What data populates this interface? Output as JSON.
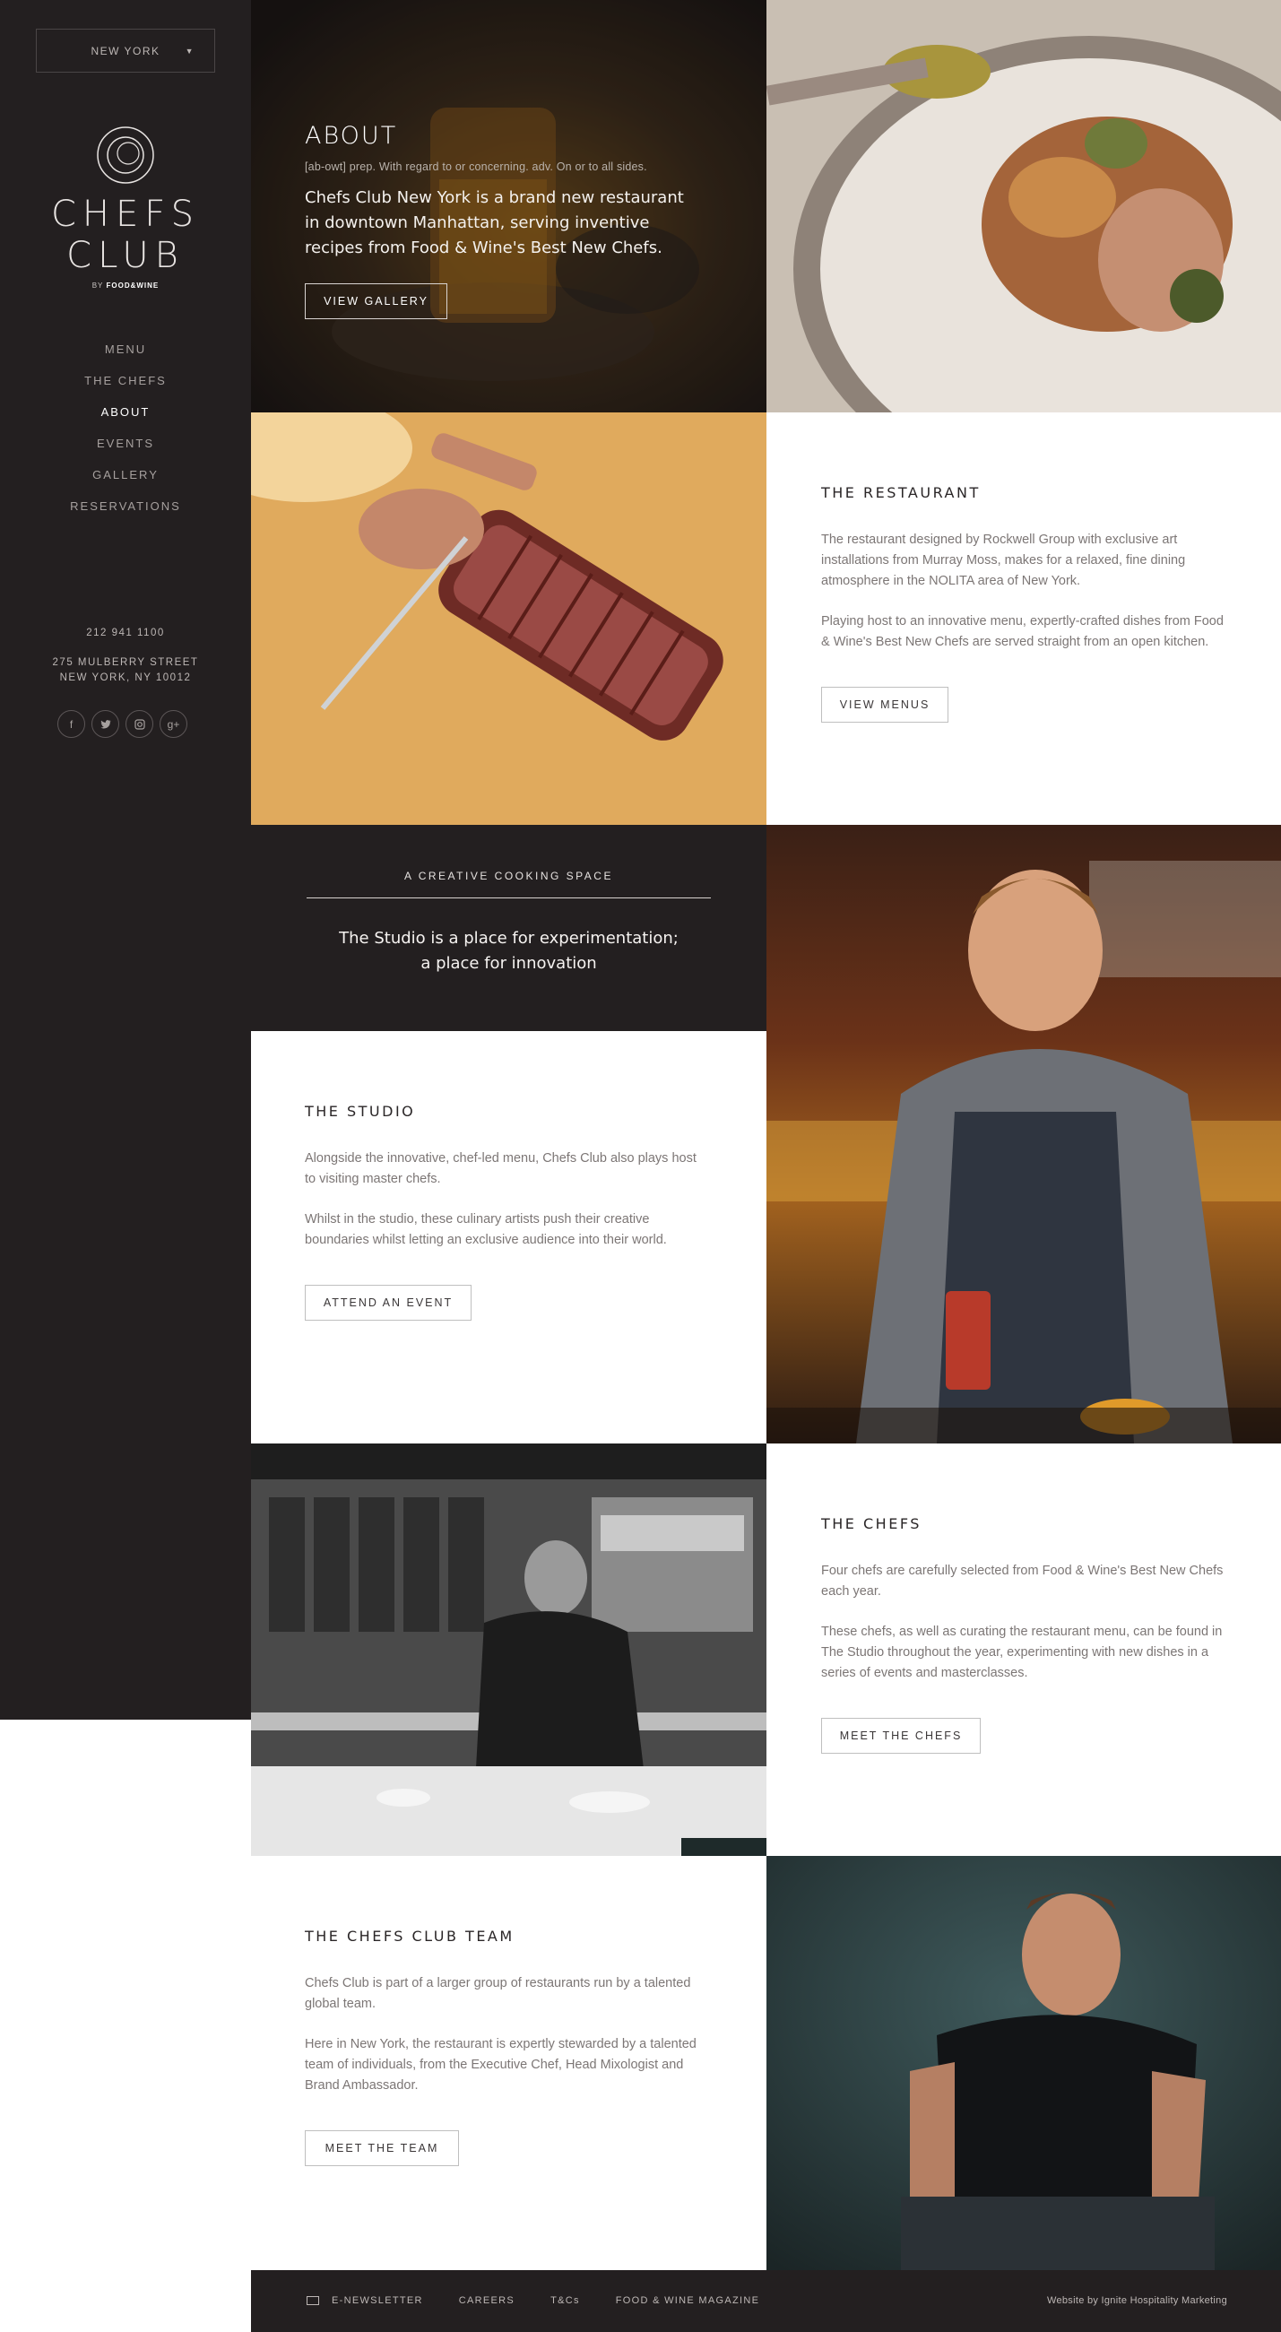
{
  "location_selector": {
    "value": "NEW YORK"
  },
  "brand": {
    "name_line1": "CHEFS",
    "name_line2": "CLUB",
    "byline_prefix": "BY",
    "byline_brand": "FOOD&WINE"
  },
  "nav": {
    "items": [
      {
        "label": "MENU",
        "active": false
      },
      {
        "label": "THE CHEFS",
        "active": false
      },
      {
        "label": "ABOUT",
        "active": true
      },
      {
        "label": "EVENTS",
        "active": false
      },
      {
        "label": "GALLERY",
        "active": false
      },
      {
        "label": "RESERVATIONS",
        "active": false
      }
    ]
  },
  "contact": {
    "phone": "212 941 1100",
    "address_line1": "275 MULBERRY STREET",
    "address_line2": "NEW YORK, NY 10012"
  },
  "socials": [
    "facebook-icon",
    "twitter-icon",
    "instagram-icon",
    "google-plus-icon"
  ],
  "about": {
    "title": "ABOUT",
    "definition": "[ab-owt] prep. With regard to or concerning. adv. On or to all sides.",
    "lead": "Chefs Club New York is a brand new restaurant in downtown Manhattan, serving inventive recipes from Food & Wine's Best New Chefs.",
    "button": "VIEW GALLERY"
  },
  "restaurant": {
    "title": "THE RESTAURANT",
    "p1": "The restaurant designed by Rockwell Group with exclusive art installations from Murray Moss, makes for a relaxed, fine dining atmosphere in the NOLITA area of New York.",
    "p2": "Playing host to an innovative menu, expertly-crafted dishes from Food & Wine's Best New Chefs are served straight from an open kitchen.",
    "button": "VIEW MENUS"
  },
  "creative": {
    "kicker": "A CREATIVE COOKING SPACE",
    "quote_line1": "The Studio is a place for experimentation;",
    "quote_line2": "a place for innovation"
  },
  "studio": {
    "title": "THE STUDIO",
    "p1": "Alongside the innovative, chef-led menu, Chefs Club also plays host to visiting master chefs.",
    "p2": "Whilst in the studio, these culinary artists push their creative boundaries whilst letting an exclusive audience into their world.",
    "button": "ATTEND AN EVENT"
  },
  "chefs": {
    "title": "THE CHEFS",
    "p1": "Four chefs are carefully selected from Food & Wine's Best New Chefs each year.",
    "p2": "These chefs, as well as curating the restaurant menu, can be found in The Studio throughout the year, experimenting with new dishes in a series of events and masterclasses.",
    "button": "MEET THE CHEFS"
  },
  "team": {
    "title": "THE CHEFS CLUB TEAM",
    "p1": "Chefs Club is part of a larger group of restaurants run by a talented global team.",
    "p2": "Here in New York, the restaurant is expertly stewarded by a talented team of individuals, from the Executive Chef, Head Mixologist and Brand Ambassador.",
    "button": "MEET THE TEAM"
  },
  "footer": {
    "links": [
      "E-NEWSLETTER",
      "CAREERS",
      "T&Cs",
      "FOOD & WINE MAGAZINE"
    ],
    "credit": "Website by Ignite Hospitality Marketing"
  },
  "colors": {
    "sidebar_bg": "#231f20",
    "footer_bg": "#231f20",
    "text_dark": "#2a2627",
    "text_body": "#7c7675"
  }
}
